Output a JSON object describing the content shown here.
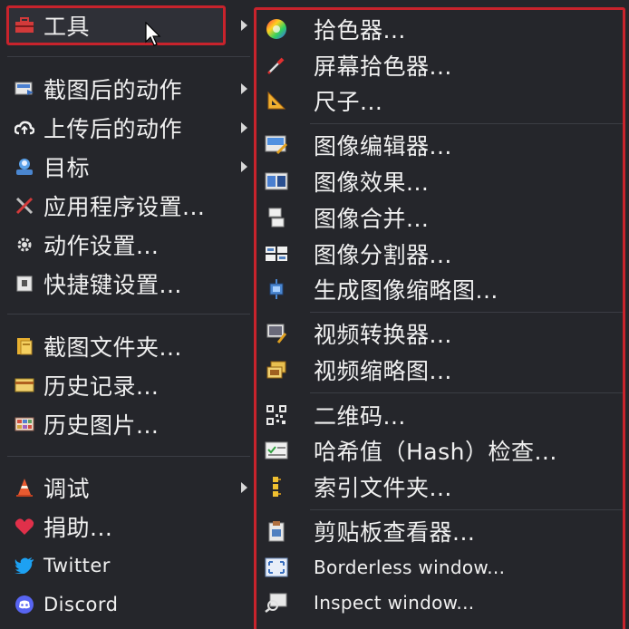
{
  "left_menu": {
    "items": [
      {
        "label": "工具",
        "icon": "toolbox-icon",
        "submenu": true
      },
      {
        "label": "截图后的动作",
        "icon": "screen-action-icon",
        "submenu": true
      },
      {
        "label": "上传后的动作",
        "icon": "cloud-upload-icon",
        "submenu": true
      },
      {
        "label": "目标",
        "icon": "target-user-icon",
        "submenu": true
      },
      {
        "label": "应用程序设置...",
        "icon": "wrench-icon",
        "submenu": false
      },
      {
        "label": "动作设置...",
        "icon": "gear-icon",
        "submenu": false
      },
      {
        "label": "快捷键设置...",
        "icon": "keyboard-icon",
        "submenu": false
      },
      {
        "label": "截图文件夹...",
        "icon": "folder-icon",
        "submenu": false
      },
      {
        "label": "历史记录...",
        "icon": "history-card-icon",
        "submenu": false
      },
      {
        "label": "历史图片...",
        "icon": "image-history-icon",
        "submenu": false
      },
      {
        "label": "调试",
        "icon": "traffic-cone-icon",
        "submenu": true
      },
      {
        "label": "捐助...",
        "icon": "heart-icon",
        "submenu": false
      },
      {
        "label": "Twitter",
        "icon": "twitter-bird-icon",
        "submenu": false
      },
      {
        "label": "Discord",
        "icon": "discord-icon",
        "submenu": false
      }
    ]
  },
  "right_menu": {
    "items": [
      {
        "label": "拾色器...",
        "icon": "color-wheel-icon"
      },
      {
        "label": "屏幕拾色器...",
        "icon": "eyedropper-icon"
      },
      {
        "label": "尺子...",
        "icon": "ruler-triangle-icon"
      },
      {
        "label": "图像编辑器...",
        "icon": "image-editor-icon"
      },
      {
        "label": "图像效果...",
        "icon": "image-effects-icon"
      },
      {
        "label": "图像合并...",
        "icon": "image-combine-icon"
      },
      {
        "label": "图像分割器...",
        "icon": "image-split-icon"
      },
      {
        "label": "生成图像缩略图...",
        "icon": "thumbnail-icon"
      },
      {
        "label": "视频转换器...",
        "icon": "video-converter-icon"
      },
      {
        "label": "视频缩略图...",
        "icon": "video-thumbnail-icon"
      },
      {
        "label": "二维码...",
        "icon": "qr-code-icon"
      },
      {
        "label": "哈希值（Hash）检查...",
        "icon": "hash-check-icon"
      },
      {
        "label": "索引文件夹...",
        "icon": "index-folder-icon"
      },
      {
        "label": "剪贴板查看器...",
        "icon": "clipboard-icon"
      },
      {
        "label": "Borderless window...",
        "icon": "borderless-window-icon"
      },
      {
        "label": "Inspect window...",
        "icon": "inspect-window-icon"
      }
    ]
  },
  "colors": {
    "highlight_border": "#c8232c",
    "menu_background": "#25262b",
    "text": "#f0f0f0"
  }
}
